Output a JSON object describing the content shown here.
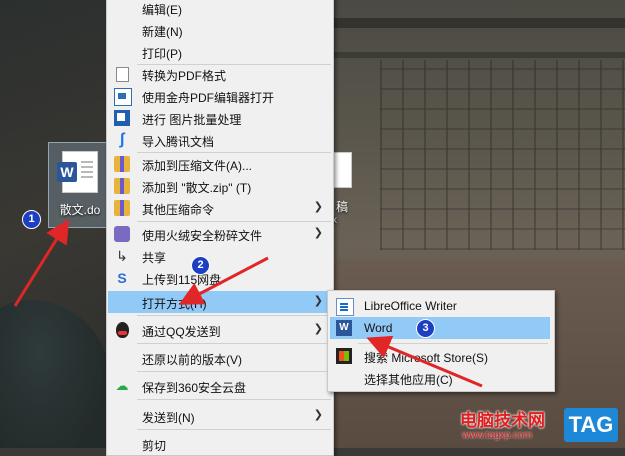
{
  "desktop": {
    "icons": [
      {
        "label": "散文.do"
      },
      {
        "label": "稿",
        "sublabel": "x"
      }
    ]
  },
  "context_menu": {
    "items": [
      {
        "label": "编辑(E)",
        "icon": "none",
        "submenu": false
      },
      {
        "label": "新建(N)",
        "icon": "none",
        "submenu": false
      },
      {
        "label": "打印(P)",
        "icon": "none",
        "submenu": false
      },
      {
        "label": "转换为PDF格式",
        "icon": "page-icon",
        "submenu": false
      },
      {
        "label": "使用金舟PDF编辑器打开",
        "icon": "pdf-editor-icon",
        "submenu": false
      },
      {
        "label": "进行 图片批量处理",
        "icon": "batch-image-icon",
        "submenu": false
      },
      {
        "label": "导入腾讯文档",
        "icon": "tencent-docs-icon",
        "submenu": false
      },
      {
        "label": "添加到压缩文件(A)...",
        "icon": "archive-icon",
        "submenu": false
      },
      {
        "label": "添加到 \"散文.zip\" (T)",
        "icon": "archive-icon",
        "submenu": false
      },
      {
        "label": "其他压缩命令",
        "icon": "archive-icon",
        "submenu": true
      },
      {
        "label": "使用火绒安全粉碎文件",
        "icon": "shredder-icon",
        "submenu": true
      },
      {
        "label": "共享",
        "icon": "share-icon",
        "submenu": false
      },
      {
        "label": "上传到115网盘",
        "icon": "cloud-115-icon",
        "submenu": false
      },
      {
        "label": "打开方式(H)",
        "icon": "none",
        "submenu": true,
        "highlighted": true
      },
      {
        "label": "通过QQ发送到",
        "icon": "qq-icon",
        "submenu": true
      },
      {
        "label": "还原以前的版本(V)",
        "icon": "none",
        "submenu": false
      },
      {
        "label": "保存到360安全云盘",
        "icon": "cloud-360-icon",
        "submenu": false
      },
      {
        "label": "发送到(N)",
        "icon": "none",
        "submenu": true
      },
      {
        "label": "剪切",
        "icon": "none",
        "submenu": false
      }
    ]
  },
  "open_with_submenu": {
    "items": [
      {
        "label": "LibreOffice Writer",
        "icon": "libreoffice-writer-icon"
      },
      {
        "label": "Word",
        "icon": "word-icon",
        "highlighted": true
      },
      {
        "label": "搜索 Microsoft Store(S)",
        "icon": "microsoft-store-icon"
      },
      {
        "label": "选择其他应用(C)",
        "icon": "none"
      }
    ]
  },
  "annotations": {
    "step1": "1",
    "step2": "2",
    "step3": "3",
    "arrow_color": "#e02626",
    "badge_color": "#1d3fc2"
  },
  "watermark": {
    "title": "电脑技术网",
    "url": "www.tagxp.com",
    "tag": "TAG"
  },
  "colors": {
    "menu_bg": "#f0f0f0",
    "highlight": "#91c9f7",
    "word_blue": "#2b579a"
  }
}
